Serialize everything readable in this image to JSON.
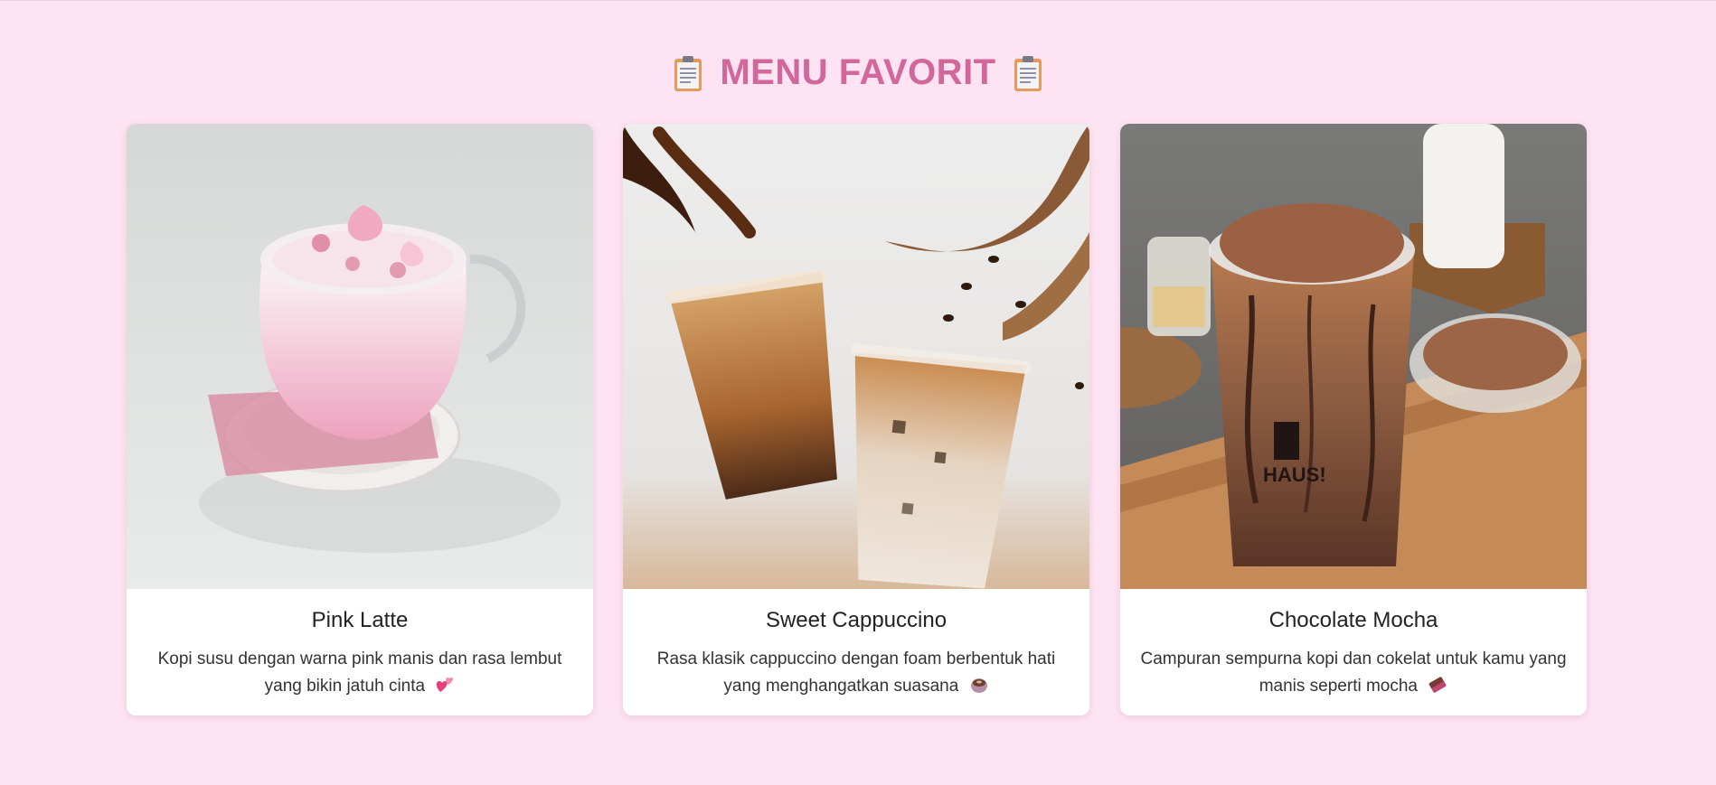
{
  "section": {
    "title": "MENU FAVORIT",
    "title_icon": "clipboard-icon",
    "accent_color": "#d1679a",
    "background_color": "#fee4f3"
  },
  "menu": [
    {
      "name": "Pink Latte",
      "description": "Kopi susu dengan warna pink manis dan rasa lembut yang bikin jatuh cinta",
      "emoji_icon": "two-hearts-icon"
    },
    {
      "name": "Sweet Cappuccino",
      "description": "Rasa klasik cappuccino dengan foam berbentuk hati yang menghangatkan suasana",
      "emoji_icon": "coffee-cup-icon"
    },
    {
      "name": "Chocolate Mocha",
      "description": "Campuran sempurna kopi dan cokelat untuk kamu yang manis seperti mocha",
      "emoji_icon": "chocolate-bar-icon"
    }
  ],
  "photo_text": {
    "cup_brand": "HAUS!"
  }
}
